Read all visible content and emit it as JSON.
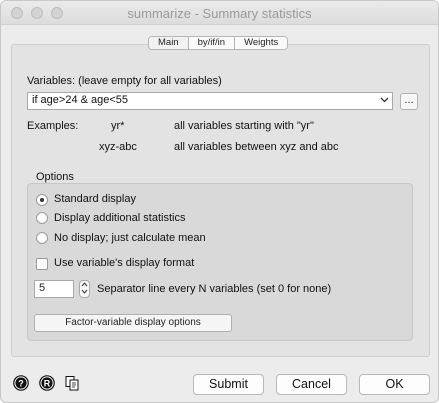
{
  "window": {
    "title": "summarize - Summary statistics"
  },
  "tabs": [
    {
      "label": "Main"
    },
    {
      "label": "by/if/in"
    },
    {
      "label": "Weights"
    }
  ],
  "variables": {
    "label": "Variables: (leave empty for all variables)",
    "value": "if age>24 & age<55",
    "browse_label": "..."
  },
  "examples": {
    "label": "Examples:",
    "rows": [
      {
        "pattern": "yr*",
        "description": "all variables starting with \"yr\""
      },
      {
        "pattern": "xyz-abc",
        "description": "all variables between xyz and abc"
      }
    ]
  },
  "options": {
    "legend": "Options",
    "radios": [
      {
        "label": "Standard display",
        "selected": true
      },
      {
        "label": "Display additional statistics",
        "selected": false
      },
      {
        "label": "No display; just calculate mean",
        "selected": false
      }
    ],
    "checkbox": {
      "label": "Use variable's display format",
      "checked": false
    },
    "separator": {
      "value": "5",
      "label": "Separator line every N variables (set 0 for none)"
    },
    "factor_button": "Factor-variable display options"
  },
  "footer": {
    "submit": "Submit",
    "cancel": "Cancel",
    "ok": "OK"
  },
  "icons": {
    "help": "help-icon",
    "reset": "reset-icon",
    "copy": "copy-icon",
    "dropdown": "chevron-down-icon",
    "stepper": "stepper-icon"
  }
}
